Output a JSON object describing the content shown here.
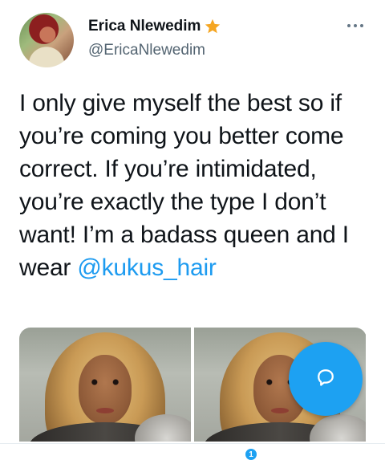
{
  "author": {
    "display_name": "Erica Nlewedim",
    "handle": "@EricaNlewedim",
    "badge_icon": "star-icon",
    "badge_color": "#f5a623"
  },
  "tweet": {
    "text": "I only give myself the best so if you’re coming you better come correct. If you’re intimidated, you’re exactly the type I don’t want! I’m a badass queen and I wear ",
    "mention": "@kukus_hair"
  },
  "media": {
    "photos": [
      {
        "icon": "photo-image"
      },
      {
        "icon": "photo-image"
      }
    ]
  },
  "fab": {
    "icon": "reply-icon",
    "color": "#1da1f2"
  },
  "bottom_nav": {
    "notification_count": "1"
  },
  "colors": {
    "accent": "#1d9bf0",
    "text": "#0f1419",
    "secondary": "#536471"
  }
}
